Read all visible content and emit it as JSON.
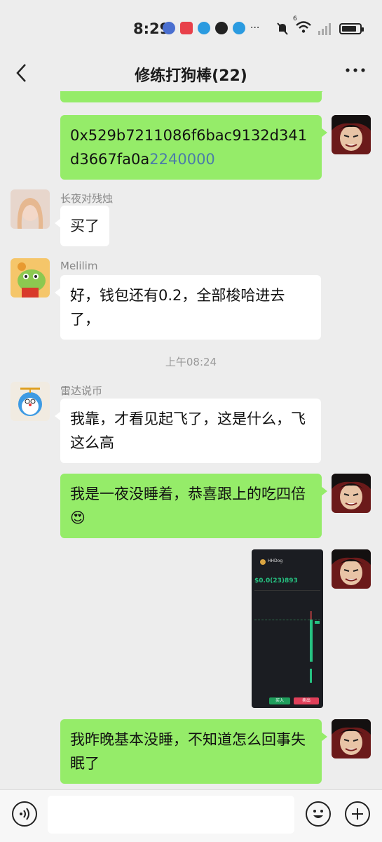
{
  "status_bar": {
    "time": "8:29",
    "more": "···",
    "network_sup": "6"
  },
  "header": {
    "title": "修练打狗棒(22)",
    "back_icon": "chevron-left-icon",
    "more_icon": "more-dots-icon"
  },
  "messages": [
    {
      "from": "me",
      "text_main": "0x529b7211086f6bac9132d341d3667fa0a",
      "text_tail": "2240000"
    },
    {
      "from": "other",
      "sender": "长夜对残烛",
      "text": "买了"
    },
    {
      "from": "other",
      "sender": "Melilim",
      "text": "好，钱包还有0.2，全部梭哈进去了，"
    },
    {
      "type": "timestamp",
      "text": "上午08:24"
    },
    {
      "from": "other",
      "sender": "雷达说币",
      "text": "我靠，才看见起飞了，这是什么，飞这么高"
    },
    {
      "from": "me",
      "text": "我是一夜没睡着，恭喜跟上的吃四倍",
      "emoji": "😍"
    },
    {
      "from": "me",
      "type": "image",
      "image": {
        "coin": "HHDog",
        "price": "$0.0(23)893",
        "buy": "买入",
        "sell": "卖出"
      }
    },
    {
      "from": "me",
      "text": "我昨晚基本没睡，不知道怎么回事失眠了"
    }
  ],
  "input_bar": {
    "voice_icon": "voice-icon",
    "emoji_icon": "emoji-icon",
    "plus_icon": "plus-icon"
  },
  "colors": {
    "me_bubble": "#95ec69",
    "other_bubble": "#ffffff",
    "background": "#ededed"
  }
}
